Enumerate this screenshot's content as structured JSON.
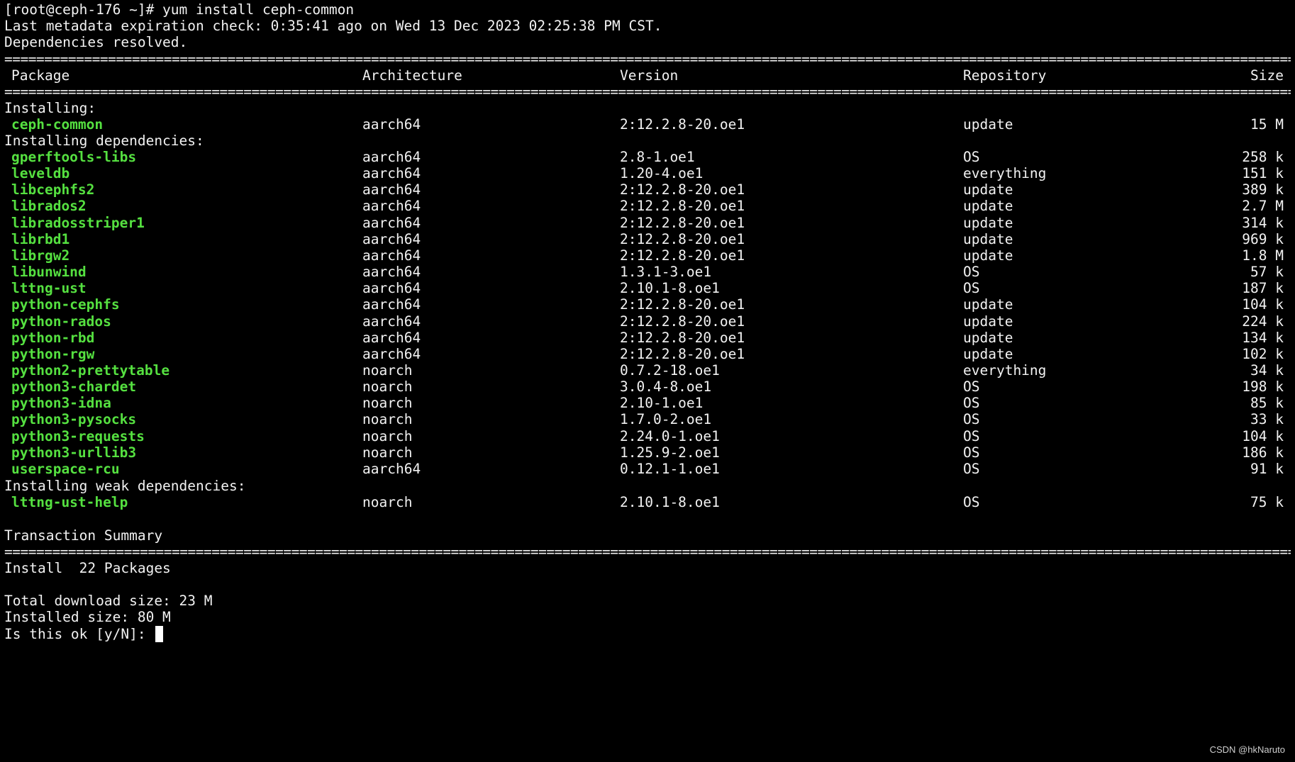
{
  "terminal": {
    "command_line": "[root@ceph-176 ~]# yum install ceph-common",
    "metadata_line": "Last metadata expiration check: 0:35:41 ago on Wed 13 Dec 2023 02:25:38 PM CST.",
    "resolved_line": "Dependencies resolved.",
    "separator": "==========================================================================================================================================================================================================================================",
    "headers": {
      "package": "Package",
      "arch": "Architecture",
      "version": "Version",
      "repo": "Repository",
      "size": "Size"
    },
    "section_installing": "Installing:",
    "installing": [
      {
        "name": "ceph-common",
        "arch": "aarch64",
        "version": "2:12.2.8-20.oe1",
        "repo": "update",
        "size": "15 M"
      }
    ],
    "section_deps": "Installing dependencies:",
    "deps": [
      {
        "name": "gperftools-libs",
        "arch": "aarch64",
        "version": "2.8-1.oe1",
        "repo": "OS",
        "size": "258 k"
      },
      {
        "name": "leveldb",
        "arch": "aarch64",
        "version": "1.20-4.oe1",
        "repo": "everything",
        "size": "151 k"
      },
      {
        "name": "libcephfs2",
        "arch": "aarch64",
        "version": "2:12.2.8-20.oe1",
        "repo": "update",
        "size": "389 k"
      },
      {
        "name": "librados2",
        "arch": "aarch64",
        "version": "2:12.2.8-20.oe1",
        "repo": "update",
        "size": "2.7 M"
      },
      {
        "name": "libradosstriper1",
        "arch": "aarch64",
        "version": "2:12.2.8-20.oe1",
        "repo": "update",
        "size": "314 k"
      },
      {
        "name": "librbd1",
        "arch": "aarch64",
        "version": "2:12.2.8-20.oe1",
        "repo": "update",
        "size": "969 k"
      },
      {
        "name": "librgw2",
        "arch": "aarch64",
        "version": "2:12.2.8-20.oe1",
        "repo": "update",
        "size": "1.8 M"
      },
      {
        "name": "libunwind",
        "arch": "aarch64",
        "version": "1.3.1-3.oe1",
        "repo": "OS",
        "size": "57 k"
      },
      {
        "name": "lttng-ust",
        "arch": "aarch64",
        "version": "2.10.1-8.oe1",
        "repo": "OS",
        "size": "187 k"
      },
      {
        "name": "python-cephfs",
        "arch": "aarch64",
        "version": "2:12.2.8-20.oe1",
        "repo": "update",
        "size": "104 k"
      },
      {
        "name": "python-rados",
        "arch": "aarch64",
        "version": "2:12.2.8-20.oe1",
        "repo": "update",
        "size": "224 k"
      },
      {
        "name": "python-rbd",
        "arch": "aarch64",
        "version": "2:12.2.8-20.oe1",
        "repo": "update",
        "size": "134 k"
      },
      {
        "name": "python-rgw",
        "arch": "aarch64",
        "version": "2:12.2.8-20.oe1",
        "repo": "update",
        "size": "102 k"
      },
      {
        "name": "python2-prettytable",
        "arch": "noarch",
        "version": "0.7.2-18.oe1",
        "repo": "everything",
        "size": "34 k"
      },
      {
        "name": "python3-chardet",
        "arch": "noarch",
        "version": "3.0.4-8.oe1",
        "repo": "OS",
        "size": "198 k"
      },
      {
        "name": "python3-idna",
        "arch": "noarch",
        "version": "2.10-1.oe1",
        "repo": "OS",
        "size": "85 k"
      },
      {
        "name": "python3-pysocks",
        "arch": "noarch",
        "version": "1.7.0-2.oe1",
        "repo": "OS",
        "size": "33 k"
      },
      {
        "name": "python3-requests",
        "arch": "noarch",
        "version": "2.24.0-1.oe1",
        "repo": "OS",
        "size": "104 k"
      },
      {
        "name": "python3-urllib3",
        "arch": "noarch",
        "version": "1.25.9-2.oe1",
        "repo": "OS",
        "size": "186 k"
      },
      {
        "name": "userspace-rcu",
        "arch": "aarch64",
        "version": "0.12.1-1.oe1",
        "repo": "OS",
        "size": "91 k"
      }
    ],
    "section_weak": "Installing weak dependencies:",
    "weak": [
      {
        "name": "lttng-ust-help",
        "arch": "noarch",
        "version": "2.10.1-8.oe1",
        "repo": "OS",
        "size": "75 k"
      }
    ],
    "summary_title": "Transaction Summary",
    "install_count_line": "Install  22 Packages",
    "total_download_line": "Total download size: 23 M",
    "installed_size_line": "Installed size: 80 M",
    "prompt_line": "Is this ok [y/N]: ",
    "watermark": "CSDN @hkNaruto",
    "colors": {
      "background": "#000000",
      "text": "#f2f2f2",
      "package_name": "#55e040"
    }
  }
}
